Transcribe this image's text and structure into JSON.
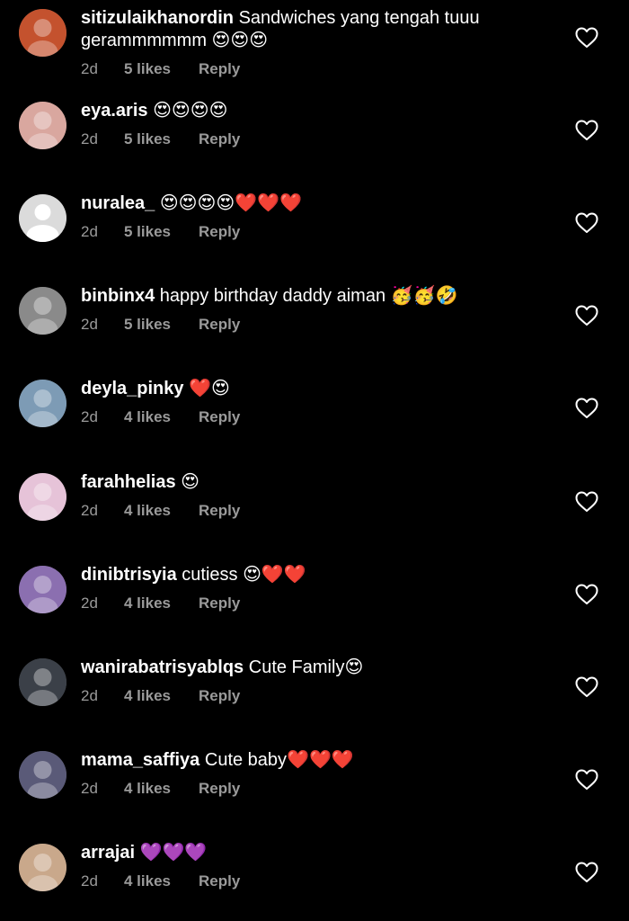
{
  "comments": [
    {
      "username": "sitizulaikhanordin",
      "text": "Sandwiches yang tengah tuuu",
      "text2": "gerammmmmm 😍😍😍",
      "time": "2d",
      "likes": "5 likes",
      "reply": "Reply",
      "avatar_bg": "#c4522e"
    },
    {
      "username": "eya.aris",
      "text": "😍😍😍😍",
      "time": "2d",
      "likes": "5 likes",
      "reply": "Reply",
      "avatar_bg": "#d9a79f"
    },
    {
      "username": "nuralea_",
      "text": "😍😍😍😍❤️❤️❤️",
      "time": "2d",
      "likes": "5 likes",
      "reply": "Reply",
      "avatar_bg": "#dbdbdb"
    },
    {
      "username": "binbinx4",
      "text": "happy birthday daddy aiman 🥳🥳🤣",
      "time": "2d",
      "likes": "5 likes",
      "reply": "Reply",
      "avatar_bg": "#8a8a8a"
    },
    {
      "username": "deyla_pinky",
      "text": "❤️😍",
      "time": "2d",
      "likes": "4 likes",
      "reply": "Reply",
      "avatar_bg": "#7d9bb5"
    },
    {
      "username": "farahhelias",
      "text": "😍",
      "time": "2d",
      "likes": "4 likes",
      "reply": "Reply",
      "avatar_bg": "#e6c3d8"
    },
    {
      "username": "dinibtrisyia",
      "text": "cutiess 😍❤️❤️",
      "time": "2d",
      "likes": "4 likes",
      "reply": "Reply",
      "avatar_bg": "#8b6fb0"
    },
    {
      "username": "wanirabatrisyablqs",
      "text": "Cute Family😍",
      "time": "2d",
      "likes": "4 likes",
      "reply": "Reply",
      "avatar_bg": "#3b4048"
    },
    {
      "username": "mama_saffiya",
      "text": "Cute baby❤️❤️❤️",
      "time": "2d",
      "likes": "4 likes",
      "reply": "Reply",
      "avatar_bg": "#5a5a78"
    },
    {
      "username": "arrajai",
      "text": "💜💜💜",
      "time": "2d",
      "likes": "4 likes",
      "reply": "Reply",
      "avatar_bg": "#c9a88b"
    }
  ],
  "icons": {
    "like": "heart-outline-icon",
    "default_avatar": "default-avatar-icon"
  },
  "colors": {
    "background": "#000000",
    "text": "#ffffff",
    "meta": "#9a9a9a"
  }
}
